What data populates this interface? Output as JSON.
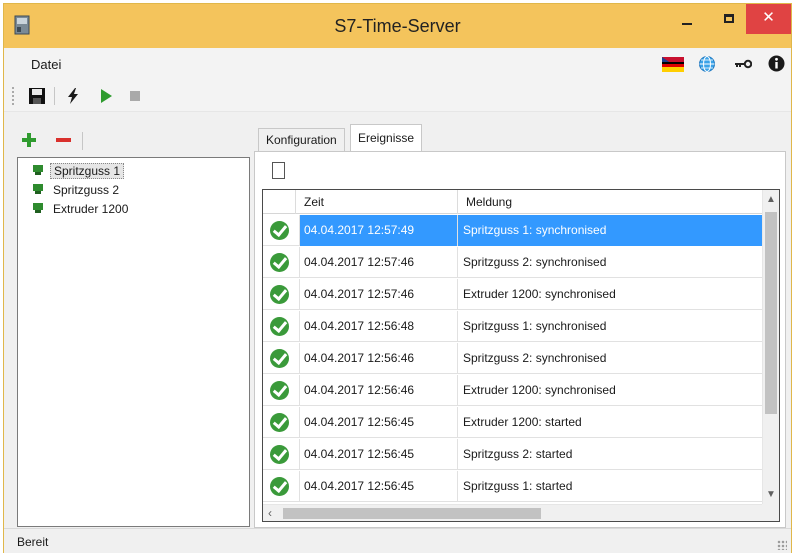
{
  "window": {
    "title": "S7-Time-Server",
    "close_glyph": "✕"
  },
  "menu": {
    "datei": "Datei",
    "icons": [
      "flag-icon",
      "globe-icon",
      "key-icon",
      "info-icon"
    ]
  },
  "toolbar": {
    "icons": [
      "save-icon",
      "lightning-icon",
      "play-icon",
      "stop-icon"
    ]
  },
  "tree": {
    "items": [
      {
        "label": "Spritzguss 1",
        "selected": true
      },
      {
        "label": "Spritzguss 2",
        "selected": false
      },
      {
        "label": "Extruder 1200",
        "selected": false
      }
    ]
  },
  "tabs": {
    "konfiguration": "Konfiguration",
    "ereignisse": "Ereignisse",
    "active": "ereignisse"
  },
  "events": {
    "columns": {
      "zeit": "Zeit",
      "meldung": "Meldung"
    },
    "rows": [
      {
        "zeit": "04.04.2017 12:57:49",
        "meldung": "Spritzguss 1: synchronised",
        "selected": true
      },
      {
        "zeit": "04.04.2017 12:57:46",
        "meldung": "Spritzguss 2: synchronised"
      },
      {
        "zeit": "04.04.2017 12:57:46",
        "meldung": "Extruder 1200: synchronised"
      },
      {
        "zeit": "04.04.2017 12:56:48",
        "meldung": "Spritzguss 1: synchronised"
      },
      {
        "zeit": "04.04.2017 12:56:46",
        "meldung": "Spritzguss 2: synchronised"
      },
      {
        "zeit": "04.04.2017 12:56:46",
        "meldung": "Extruder 1200: synchronised"
      },
      {
        "zeit": "04.04.2017 12:56:45",
        "meldung": "Extruder 1200: started"
      },
      {
        "zeit": "04.04.2017 12:56:45",
        "meldung": "Spritzguss 2: started"
      },
      {
        "zeit": "04.04.2017 12:56:45",
        "meldung": "Spritzguss 1: started"
      }
    ]
  },
  "status": {
    "text": "Bereit"
  },
  "colors": {
    "titlebar": "#f4c45c",
    "close_button": "#e04343",
    "selection": "#3399ff",
    "ok_green": "#3a9a3a"
  }
}
